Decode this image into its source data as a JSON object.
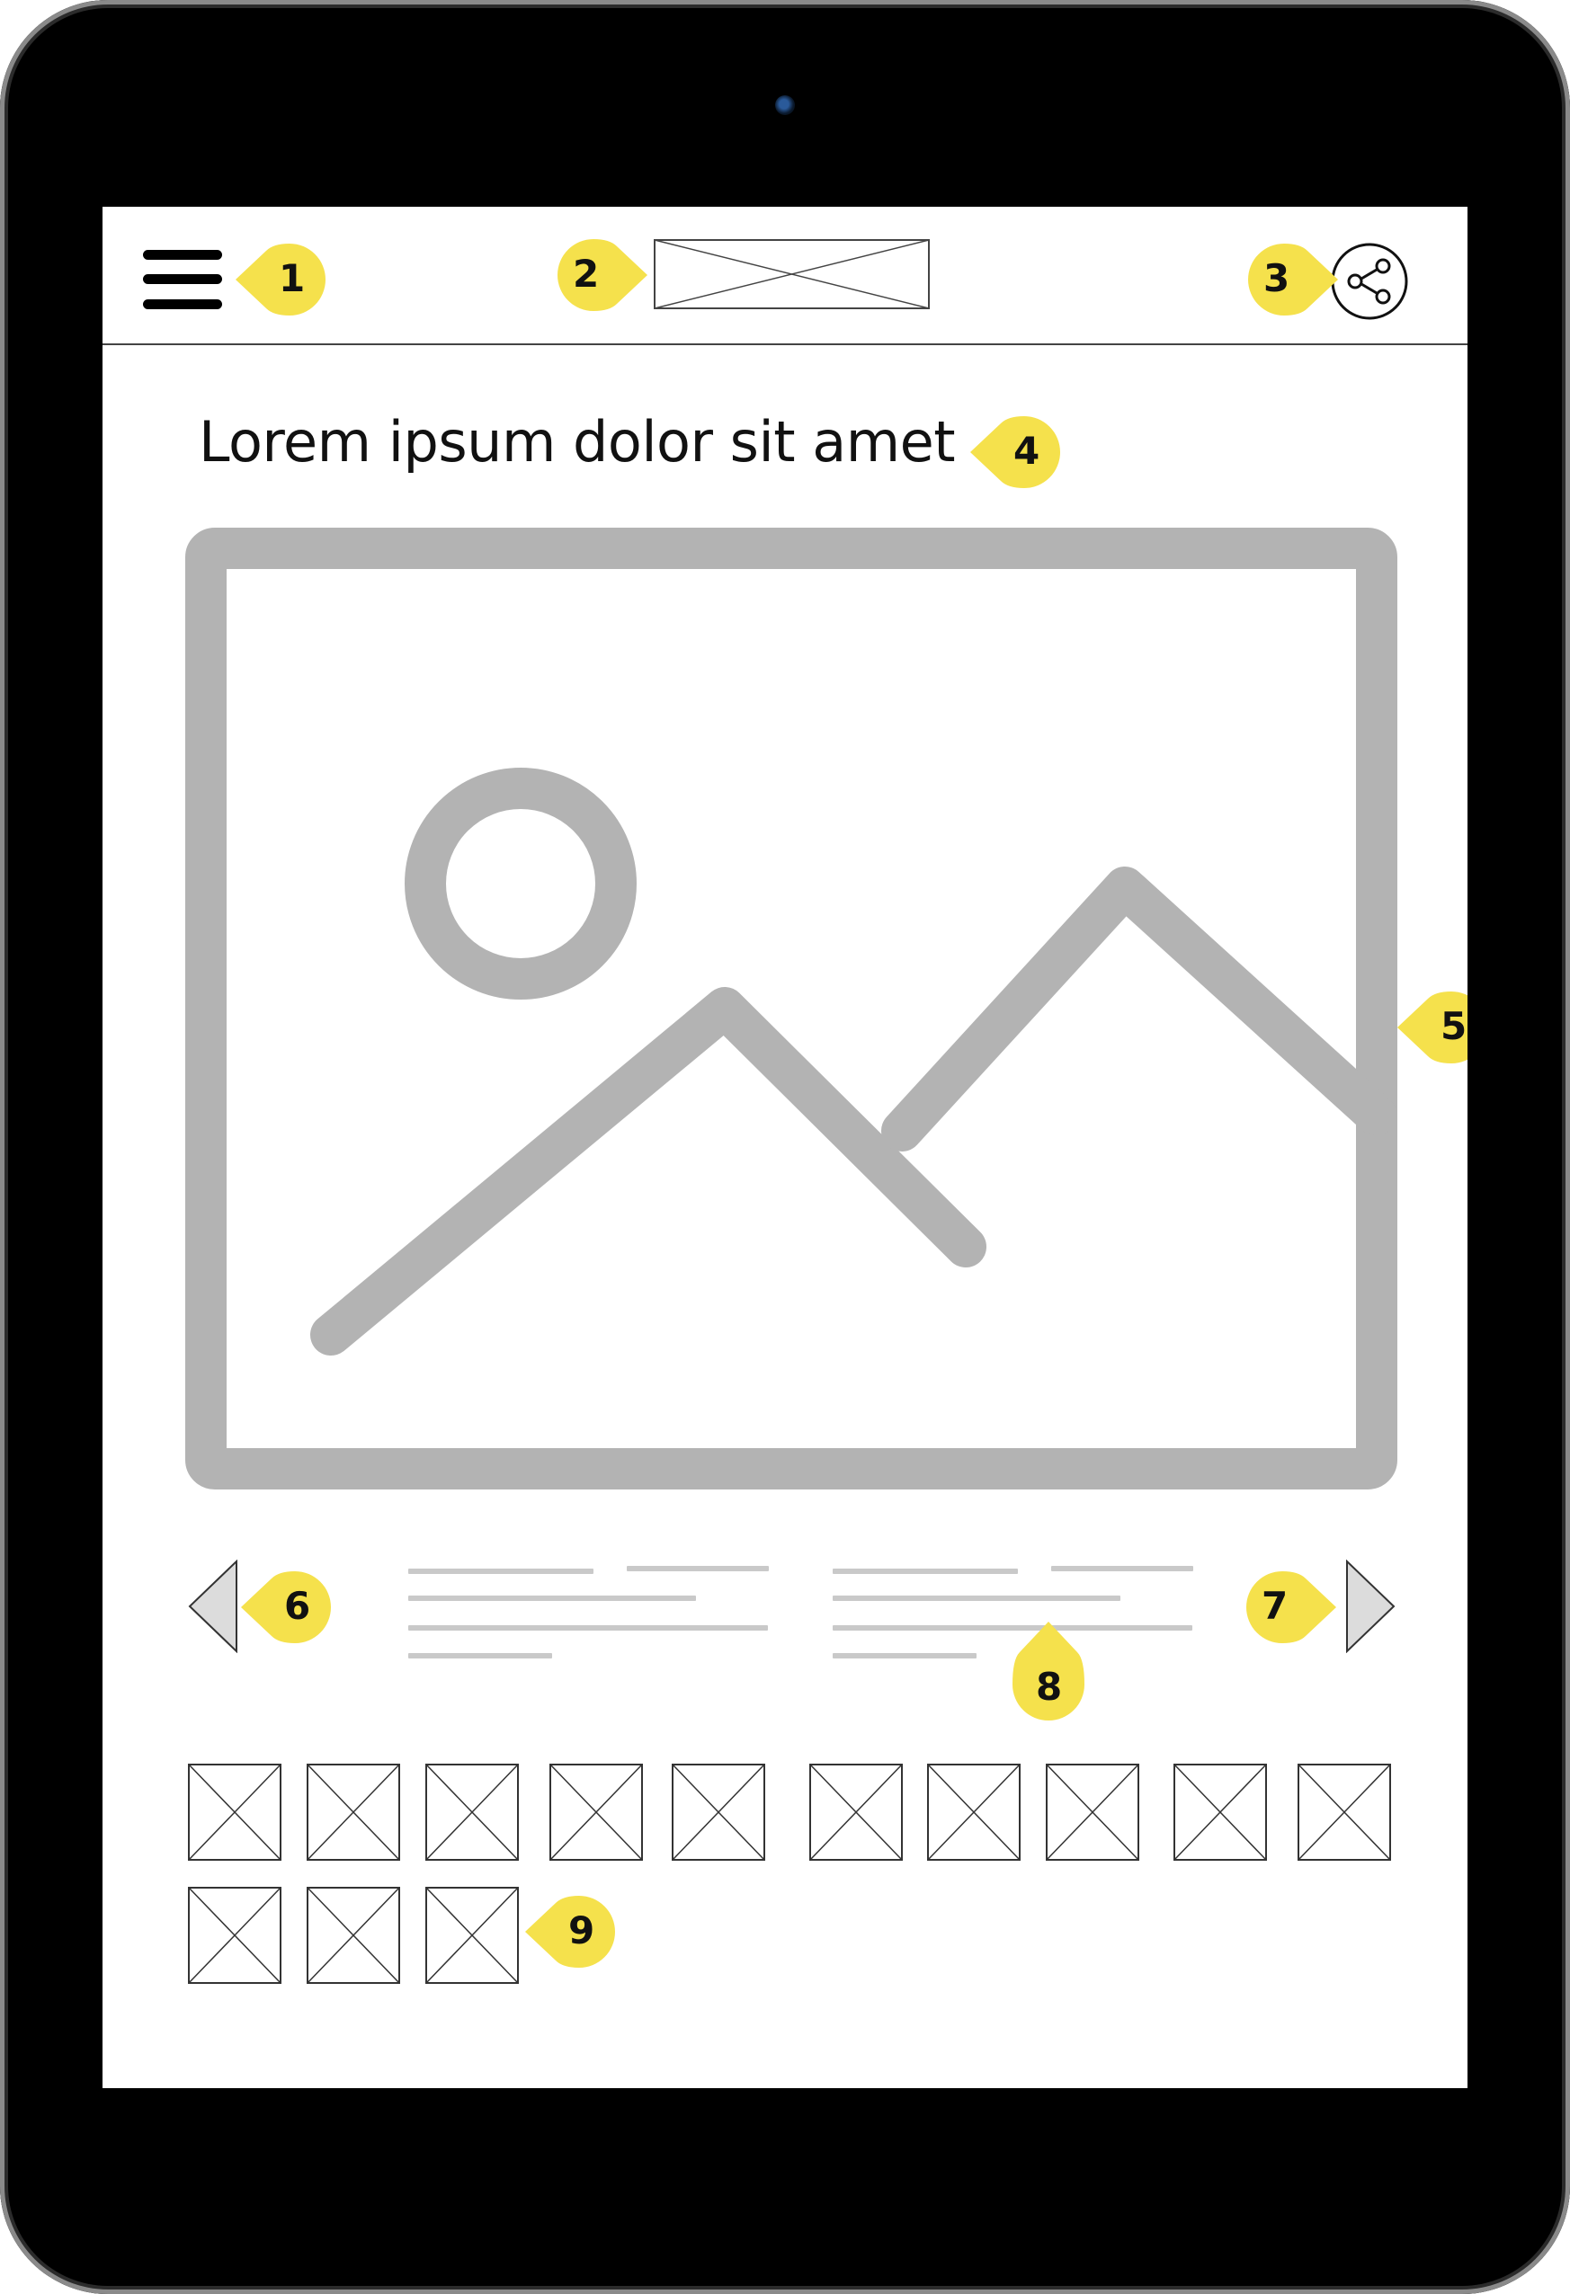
{
  "page": {
    "title": "Lorem ipsum dolor sit amet"
  },
  "icons": {
    "menu": "hamburger-icon",
    "logo": "image-placeholder",
    "share": "share-icon",
    "prev": "triangle-left",
    "next": "triangle-right",
    "hero": "image-placeholder-icon",
    "thumbnail": "image-placeholder"
  },
  "callouts": {
    "menu": "1",
    "logo": "2",
    "share": "3",
    "title": "4",
    "hero": "5",
    "prev": "6",
    "next": "7",
    "text": "8",
    "thumbnails": "9"
  },
  "thumbnails": {
    "count": 13,
    "rows": [
      10,
      3
    ]
  },
  "colors": {
    "device": "#000000",
    "screen": "#ffffff",
    "callout": "#f5e14c",
    "placeholder": "#b3b3b3",
    "text_lines": "#c9c9c9",
    "arrow_fill": "#dcdcdc"
  }
}
